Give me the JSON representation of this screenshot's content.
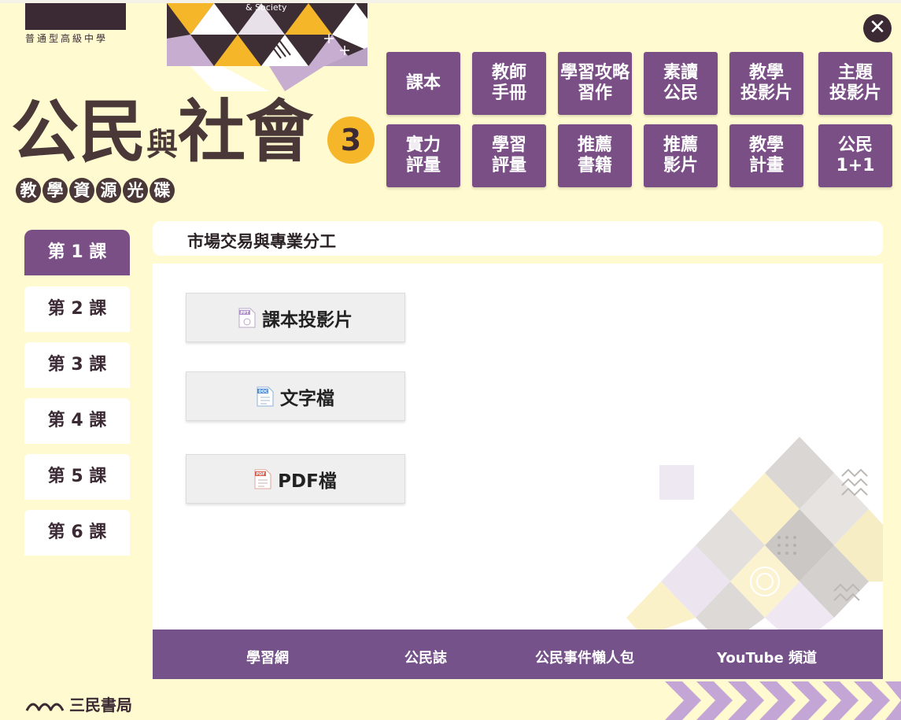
{
  "header": {
    "school_level": "普通型高級中學",
    "cover_caption": "& Society",
    "title_part1": "公民",
    "title_joiner": "與",
    "title_part2": "社會",
    "volume": "3",
    "subtitle_chars": [
      "教",
      "學",
      "資",
      "源",
      "光",
      "碟"
    ],
    "close_label": "✕"
  },
  "menu": {
    "row1": [
      {
        "line1": "課本",
        "line2": ""
      },
      {
        "line1": "教師",
        "line2": "手冊"
      },
      {
        "line1": "學習攻略",
        "line2": "習作"
      },
      {
        "line1": "素讀",
        "line2": "公民"
      },
      {
        "line1": "教學",
        "line2": "投影片"
      },
      {
        "line1": "主題",
        "line2": "投影片"
      }
    ],
    "row2": [
      {
        "line1": "實力",
        "line2": "評量"
      },
      {
        "line1": "學習",
        "line2": "評量"
      },
      {
        "line1": "推薦",
        "line2": "書籍"
      },
      {
        "line1": "推薦",
        "line2": "影片"
      },
      {
        "line1": "教學",
        "line2": "計畫"
      },
      {
        "line1": "公民",
        "line2": "1+1"
      }
    ]
  },
  "lessons": [
    "第 1 課",
    "第 2 課",
    "第 3 課",
    "第 4 課",
    "第 5 課",
    "第 6 課"
  ],
  "active_lesson": "第 1 課",
  "lesson_title": "市場交易與專業分工",
  "downloads": [
    {
      "label": "課本投影片",
      "icon": "ppt-file-icon",
      "tag": "PPT"
    },
    {
      "label": "文字檔",
      "icon": "doc-file-icon",
      "tag": "DOC"
    },
    {
      "label": "PDF檔",
      "icon": "pdf-file-icon",
      "tag": "PDF"
    }
  ],
  "footer": {
    "links": [
      "學習網",
      "公民誌",
      "公民事件懶人包",
      "YouTube 頻道"
    ]
  },
  "publisher": "三民書局",
  "colors": {
    "background": "#fffacf",
    "purple": "#7a4f86",
    "footer_purple": "#76528a",
    "dark": "#3b2a33",
    "badge": "#f5b62a"
  }
}
